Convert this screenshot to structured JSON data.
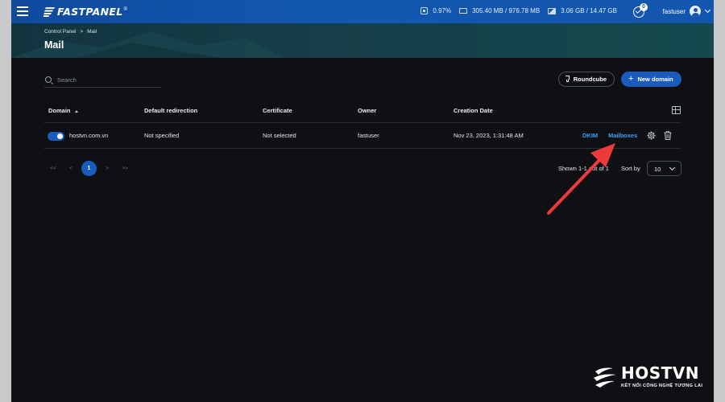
{
  "topbar": {
    "brand": "FASTPANEL",
    "brand_reg": "®",
    "stats": {
      "cpu": "0.97%",
      "memory": "305.40 MB / 976.78 MB",
      "disk": "3.06 GB / 14.47 GB"
    },
    "notifications_count": "0",
    "username": "fastuser"
  },
  "header": {
    "breadcrumb": [
      "Control Panel",
      "Mail"
    ],
    "breadcrumb_sep": ">",
    "title": "Mail"
  },
  "toolbar": {
    "search_placeholder": "Search",
    "roundcube_label": "Roundcube",
    "new_domain_label": "New domain"
  },
  "table": {
    "columns": [
      "Domain",
      "Default redirection",
      "Certificate",
      "Owner",
      "Creation Date"
    ],
    "rows": [
      {
        "enabled": true,
        "domain": "hostvn.com.vn",
        "default_redirection": "Not specified",
        "certificate": "Not selected",
        "owner": "fastuser",
        "creation_date": "Nov 23, 2023, 1:31:48 AM",
        "actions": {
          "dkim": "DKIM",
          "mailboxes": "Mailboxes"
        }
      }
    ]
  },
  "pagination": {
    "first": "<<",
    "prev": "<",
    "current": "1",
    "next": ">",
    "last": ">>",
    "shown_text": "Shown 1-1 out of 1",
    "sort_by_label": "Sort by",
    "sort_by_value": "10"
  },
  "watermark": {
    "brand": "HOSTVN",
    "tagline": "KẾT NỐI CÔNG NGHỆ TƯƠNG LAI"
  },
  "colors": {
    "accent": "#1a5cbd",
    "link": "#3ea0f4",
    "annotation_arrow": "#ee3a3a"
  }
}
